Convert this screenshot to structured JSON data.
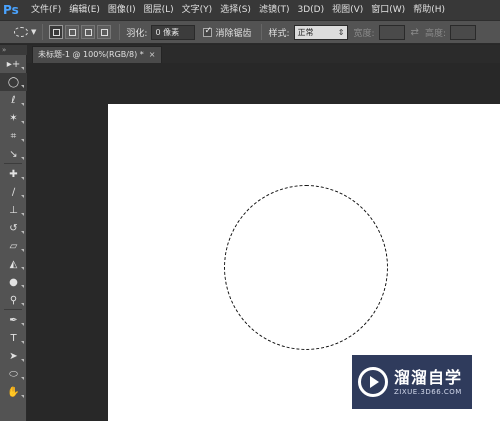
{
  "app": {
    "logo": "Ps"
  },
  "menu": [
    "文件(F)",
    "编辑(E)",
    "图像(I)",
    "图层(L)",
    "文字(Y)",
    "选择(S)",
    "滤镜(T)",
    "3D(D)",
    "视图(V)",
    "窗口(W)",
    "帮助(H)"
  ],
  "options": {
    "tool_icon": "ellipse-marquee-icon",
    "feather_label": "羽化:",
    "feather_value": "0 像素",
    "antialias_label": "消除锯齿",
    "antialias_checked": true,
    "style_label": "样式:",
    "style_value": "正常",
    "width_label": "宽度:",
    "height_label": "高度:"
  },
  "tools_header": "»",
  "tab": {
    "title": "未标题-1 @ 100%(RGB/8) *",
    "close": "×"
  },
  "tools": [
    {
      "name": "move-tool-icon",
      "glyph": "▸+"
    },
    {
      "name": "elliptical-marquee-tool-icon",
      "glyph": "◯",
      "active": true
    },
    {
      "name": "lasso-tool-icon",
      "glyph": "ℓ"
    },
    {
      "name": "magic-wand-tool-icon",
      "glyph": "✶"
    },
    {
      "name": "crop-tool-icon",
      "glyph": "⌗"
    },
    {
      "name": "eyedropper-tool-icon",
      "glyph": "↘"
    },
    {
      "name": "healing-brush-tool-icon",
      "glyph": "✚"
    },
    {
      "name": "brush-tool-icon",
      "glyph": "∕"
    },
    {
      "name": "clone-stamp-tool-icon",
      "glyph": "⊥"
    },
    {
      "name": "history-brush-tool-icon",
      "glyph": "↺"
    },
    {
      "name": "eraser-tool-icon",
      "glyph": "▱"
    },
    {
      "name": "paint-bucket-tool-icon",
      "glyph": "◭"
    },
    {
      "name": "blur-tool-icon",
      "glyph": "●"
    },
    {
      "name": "dodge-tool-icon",
      "glyph": "⚲"
    },
    {
      "name": "pen-tool-icon",
      "glyph": "✒"
    },
    {
      "name": "type-tool-icon",
      "glyph": "T"
    },
    {
      "name": "path-selection-tool-icon",
      "glyph": "➤"
    },
    {
      "name": "ellipse-shape-tool-icon",
      "glyph": "⬭"
    },
    {
      "name": "hand-tool-icon",
      "glyph": "✋"
    }
  ],
  "watermark": {
    "title": "溜溜自学",
    "subtitle": "ZIXUE.3D66.COM"
  }
}
